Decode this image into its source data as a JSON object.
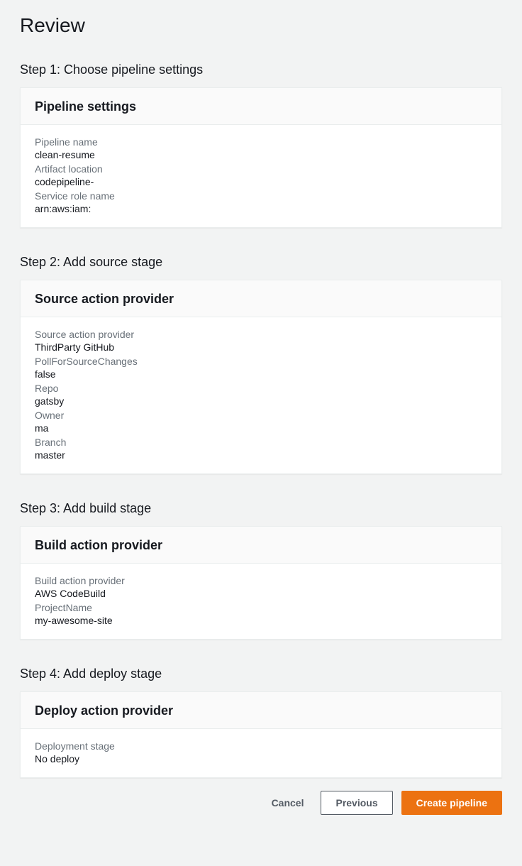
{
  "pageTitle": "Review",
  "steps": {
    "step1": {
      "title": "Step 1: Choose pipeline settings",
      "cardTitle": "Pipeline settings",
      "fields": [
        {
          "label": "Pipeline name",
          "value": "clean-resume"
        },
        {
          "label": "Artifact location",
          "value": "codepipeline-"
        },
        {
          "label": "Service role name",
          "value": "arn:aws:iam:"
        }
      ]
    },
    "step2": {
      "title": "Step 2: Add source stage",
      "cardTitle": "Source action provider",
      "fields": [
        {
          "label": "Source action provider",
          "value": "ThirdParty GitHub"
        },
        {
          "label": "PollForSourceChanges",
          "value": "false"
        },
        {
          "label": "Repo",
          "value": "gatsby"
        },
        {
          "label": "Owner",
          "value": "ma"
        },
        {
          "label": "Branch",
          "value": "master"
        }
      ]
    },
    "step3": {
      "title": "Step 3: Add build stage",
      "cardTitle": "Build action provider",
      "fields": [
        {
          "label": "Build action provider",
          "value": "AWS CodeBuild"
        },
        {
          "label": "ProjectName",
          "value": "my-awesome-site"
        }
      ]
    },
    "step4": {
      "title": "Step 4: Add deploy stage",
      "cardTitle": "Deploy action provider",
      "fields": [
        {
          "label": "Deployment stage",
          "value": "No deploy"
        }
      ]
    }
  },
  "buttons": {
    "cancel": "Cancel",
    "previous": "Previous",
    "create": "Create pipeline"
  }
}
